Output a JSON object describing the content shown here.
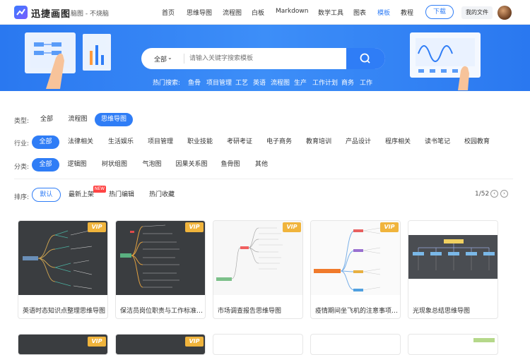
{
  "header": {
    "brand": "迅捷画图",
    "tagline": "脑图 - 不烧脑",
    "nav": [
      "首页",
      "思维导图",
      "流程图",
      "白板",
      "Markdown",
      "数学工具",
      "图表",
      "模板",
      "教程"
    ],
    "nav_active_index": 7,
    "download": "下载",
    "my_files": "我的文件"
  },
  "search": {
    "category": "全部",
    "placeholder": "请输入关键字搜索模板",
    "hot_label": "热门搜索:",
    "hot": [
      "鱼骨",
      "项目管理",
      "工艺",
      "英语",
      "流程图",
      "生产",
      "工作计划",
      "商务",
      "工作"
    ]
  },
  "filters": {
    "type": {
      "label": "类型:",
      "options": [
        "全部",
        "流程图",
        "思维导图"
      ],
      "selected": 2
    },
    "industry": {
      "label": "行业:",
      "options": [
        "全部",
        "法律相关",
        "生活娱乐",
        "项目管理",
        "职业技能",
        "考研考证",
        "电子商务",
        "教育培训",
        "产品设计",
        "程序相关",
        "读书笔记",
        "校园教育"
      ],
      "selected": 0
    },
    "category": {
      "label": "分类:",
      "options": [
        "全部",
        "逻辑图",
        "树状组图",
        "气泡图",
        "因果关系图",
        "鱼骨图",
        "其他"
      ],
      "selected": 0
    }
  },
  "sort": {
    "label": "排序:",
    "options": [
      "默认",
      "最新上架",
      "热门编辑",
      "热门收藏"
    ],
    "selected": 0,
    "new_badge": "NEW",
    "page": "1/52"
  },
  "cards": [
    {
      "title": "英语时态知识点整理思维导图",
      "vip": "VIP",
      "theme": "dark"
    },
    {
      "title": "保洁员岗位职责与工作标准思...",
      "vip": "VIP",
      "theme": "dark"
    },
    {
      "title": "市场调查报告思维导图",
      "vip": "VIP",
      "theme": "light"
    },
    {
      "title": "疫情期间坐飞机的注意事项思...",
      "vip": "VIP",
      "theme": "light"
    },
    {
      "title": "光现象总结思维导图",
      "vip": "",
      "theme": "dark"
    }
  ],
  "colors": {
    "accent": "#2f7df6",
    "vip": "#f0b43c",
    "banner": "#3a86f5",
    "new": "#ff4444"
  }
}
